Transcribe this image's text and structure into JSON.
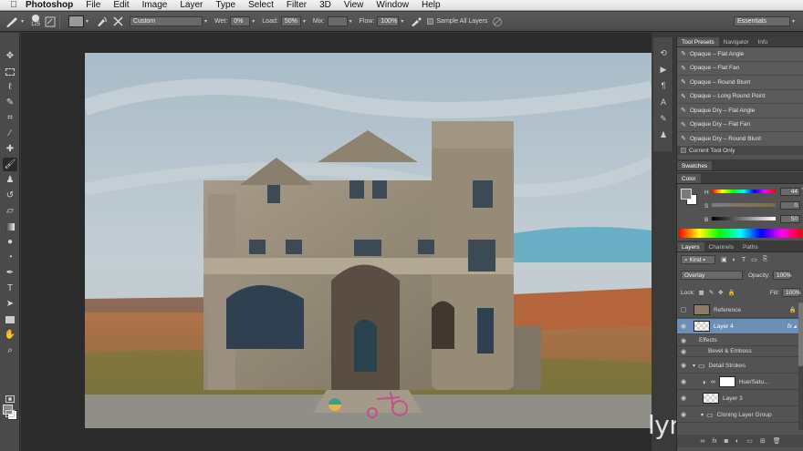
{
  "menu": {
    "app": "Photoshop",
    "items": [
      "File",
      "Edit",
      "Image",
      "Layer",
      "Type",
      "Select",
      "Filter",
      "3D",
      "View",
      "Window",
      "Help"
    ]
  },
  "options": {
    "brush_size": "125",
    "preset": "Custom",
    "wet_label": "Wet:",
    "wet_value": "0%",
    "load_label": "Load:",
    "load_value": "50%",
    "mix_label": "Mix:",
    "mix_value": "",
    "flow_label": "Flow:",
    "flow_value": "100%",
    "sample_all_label": "Sample All Layers",
    "workspace": "Essentials"
  },
  "tool_presets": {
    "tabs": [
      "Tool Presets",
      "Navigator",
      "Info"
    ],
    "items": [
      "Opaque – Flat Angle",
      "Opaque – Flat Fan",
      "Opaque – Round Blunt",
      "Opaque – Long Round Point",
      "Opaque Dry – Flat Angle",
      "Opaque Dry – Flat Fan",
      "Opaque Dry – Round Blunt"
    ],
    "current_tool_only": "Current Tool Only"
  },
  "swatches": {
    "tab": "Swatches"
  },
  "color": {
    "tab": "Color",
    "h_label": "H",
    "h_value": "44",
    "s_label": "S",
    "s_value": "0",
    "b_label": "B",
    "b_value": "50",
    "pct": "%"
  },
  "layers": {
    "tabs": [
      "Layers",
      "Channels",
      "Paths"
    ],
    "kind": "Kind",
    "blend_mode": "Overlay",
    "opacity_label": "Opacity:",
    "opacity_value": "100%",
    "lock_label": "Lock:",
    "fill_label": "Fill:",
    "fill_value": "100%",
    "rows": [
      {
        "name": "Reference"
      },
      {
        "name": "Layer 4"
      },
      {
        "name": "Effects"
      },
      {
        "name": "Bevel & Emboss"
      },
      {
        "name": "Detail Strokes"
      },
      {
        "name": "Hue/Satu..."
      },
      {
        "name": "Layer 3"
      },
      {
        "name": "Cloning Layer Group"
      }
    ]
  },
  "watermark": "lynda.com",
  "colors": {
    "panel_bg": "#535353",
    "canvas_bg": "#2b2b2b",
    "selected_layer": "#6c8fb8"
  }
}
